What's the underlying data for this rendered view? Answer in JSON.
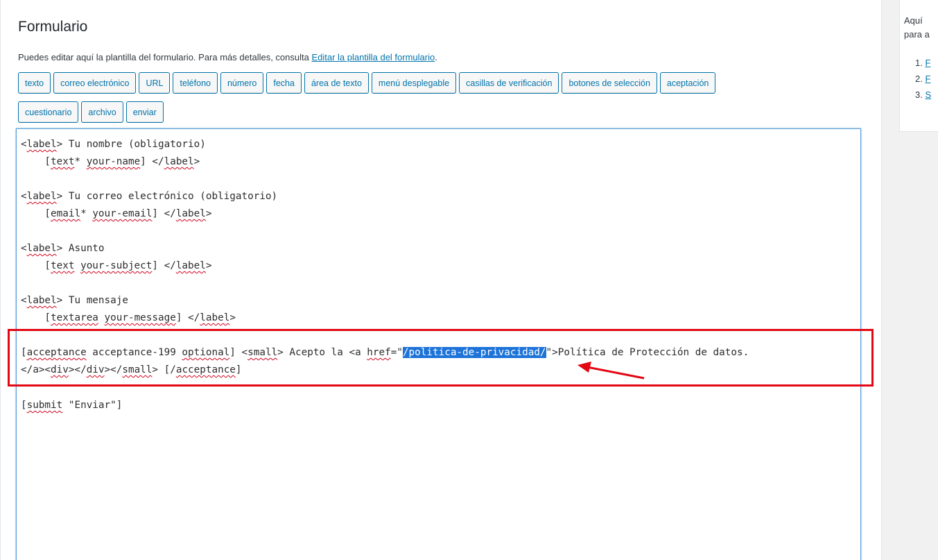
{
  "panel": {
    "title": "Formulario",
    "description_text": "Puedes editar aquí la plantilla del formulario. Para más detalles, consulta ",
    "description_link": "Editar la plantilla del formulario",
    "description_end": "."
  },
  "tag_buttons": {
    "row1": [
      "texto",
      "correo electrónico",
      "URL",
      "teléfono",
      "número",
      "fecha",
      "área de texto",
      "menú desplegable",
      "casillas de verificación",
      "botones de selección",
      "aceptación"
    ],
    "row2": [
      "cuestionario",
      "archivo",
      "enviar"
    ]
  },
  "code": {
    "l1_a": "<",
    "l1_b": "label",
    "l1_c": "> Tu nombre (obligatorio)",
    "l2_a": "    [",
    "l2_b": "text",
    "l2_c": "* ",
    "l2_d": "your-name",
    "l2_e": "] </",
    "l2_f": "label",
    "l2_g": ">",
    "l3_a": "<",
    "l3_b": "label",
    "l3_c": "> Tu correo electrónico (obligatorio)",
    "l4_a": "    [",
    "l4_b": "email",
    "l4_c": "* ",
    "l4_d": "your-email",
    "l4_e": "] </",
    "l4_f": "label",
    "l4_g": ">",
    "l5_a": "<",
    "l5_b": "label",
    "l5_c": "> Asunto",
    "l6_a": "    [",
    "l6_b": "text",
    "l6_c": " ",
    "l6_d": "your-subject",
    "l6_e": "] </",
    "l6_f": "label",
    "l6_g": ">",
    "l7_a": "<",
    "l7_b": "label",
    "l7_c": "> Tu mensaje",
    "l8_a": "    [",
    "l8_b": "textarea",
    "l8_c": " ",
    "l8_d": "your-message",
    "l8_e": "] </",
    "l8_f": "label",
    "l8_g": ">",
    "l9_a": "[",
    "l9_b": "acceptance",
    "l9_c": " acceptance-199 ",
    "l9_d": "optional",
    "l9_e": "] <",
    "l9_f": "small",
    "l9_g": "> Acepto la <a ",
    "l9_h": "href",
    "l9_i": "=\"",
    "l9_sel": "/politica-de-privacidad/",
    "l9_j": "\">Política de Protección de datos.",
    "l10_a": "</a><",
    "l10_b": "div",
    "l10_c": "></",
    "l10_d": "div",
    "l10_e": "></",
    "l10_f": "small",
    "l10_g": "> [/",
    "l10_h": "acceptance",
    "l10_i": "]",
    "l11_a": "[",
    "l11_b": "submit",
    "l11_c": " \"Enviar\"]"
  },
  "sidebar": {
    "intro_line1": "Aquí",
    "intro_line2": "para a",
    "items": [
      {
        "num": "1.",
        "label": "F"
      },
      {
        "num": "2.",
        "label": "F"
      },
      {
        "num": "3.",
        "label": "S"
      }
    ]
  },
  "colors": {
    "accent": "#0073aa",
    "annotation_red": "#e30613",
    "selection": "#1d73d8"
  }
}
